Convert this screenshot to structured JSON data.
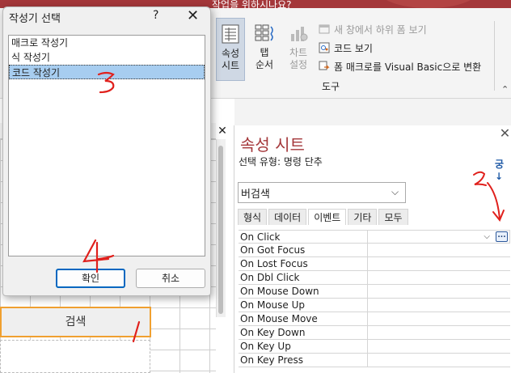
{
  "ribbon": {
    "truncated_title": "작업을 위하시나요?",
    "buttons": [
      {
        "label": "속성\n시트",
        "icon": "property-sheet-icon",
        "state": "selected"
      },
      {
        "label": "탭\n순서",
        "icon": "tab-order-icon",
        "state": "normal"
      },
      {
        "label": "차트\n설정",
        "icon": "chart-settings-icon",
        "state": "disabled"
      }
    ],
    "small_buttons": [
      {
        "label": "새 창에서 하위 폼 보기",
        "icon": "subform-icon",
        "state": "disabled"
      },
      {
        "label": "코드 보기",
        "icon": "view-code-icon",
        "state": "normal"
      },
      {
        "label": "폼 매크로를 Visual Basic으로 변환",
        "icon": "convert-macro-icon",
        "state": "normal"
      }
    ],
    "group_label": "도구"
  },
  "form": {
    "search_button_label": "검색"
  },
  "property_sheet": {
    "title": "속성 시트",
    "selection_type": "선택 유형:  명령 단추",
    "sort_glyph": "궁↓",
    "object_combo_value": "버검색",
    "tabs": [
      "형식",
      "데이터",
      "이벤트",
      "기타",
      "모두"
    ],
    "active_tab": "이벤트",
    "events": [
      "On Click",
      "On Got Focus",
      "On Lost Focus",
      "On Dbl Click",
      "On Mouse Down",
      "On Mouse Up",
      "On Mouse Move",
      "On Key Down",
      "On Key Up",
      "On Key Press"
    ],
    "build_button_label": "..."
  },
  "dialog": {
    "title": "작성기 선택",
    "help_glyph": "?",
    "close_glyph": "✕",
    "items": [
      "매크로 작성기",
      "식 작성기",
      "코드 작성기"
    ],
    "selected_index": 2,
    "ok_label": "확인",
    "cancel_label": "취소"
  },
  "annotations": [
    "1",
    "2",
    "3",
    "4"
  ],
  "colors": {
    "accent_red": "#a4373a",
    "annotation_red": "#e0201c",
    "selection_blue": "#a7cdf0",
    "focus_orange": "#f0a030",
    "default_button_blue": "#0067c0"
  }
}
